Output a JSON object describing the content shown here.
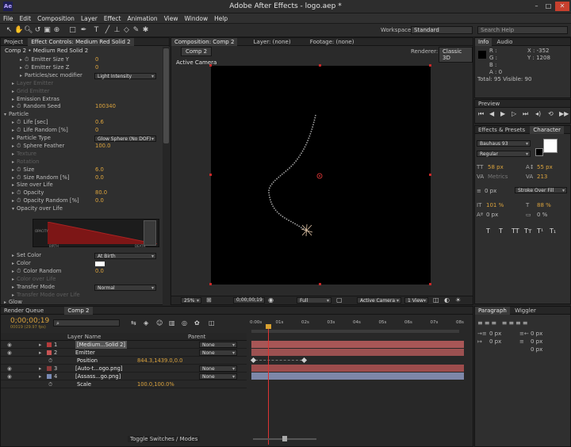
{
  "app": {
    "title": "Adobe After Effects - logo.aep *",
    "logo": "Ae",
    "min": "–",
    "max": "□",
    "close": "✕"
  },
  "menu": [
    "File",
    "Edit",
    "Composition",
    "Layer",
    "Effect",
    "Animation",
    "View",
    "Window",
    "Help"
  ],
  "toolbar": {
    "workspace_label": "Workspace:",
    "workspace_value": "Standard",
    "search_placeholder": "Search Help"
  },
  "left_panel": {
    "tabs": [
      "Project",
      "Effect Controls: Medium Red Solid 2"
    ],
    "breadcrumb": "Comp 2 • Medium Red Solid 2",
    "rows": [
      {
        "t": "Emitter Size Y",
        "v": "0",
        "i": 2,
        "k": "sw"
      },
      {
        "t": "Emitter Size Z",
        "v": "0",
        "i": 2,
        "k": "sw"
      },
      {
        "t": "Particles/sec modifier",
        "v": "Light Intensity",
        "i": 2,
        "k": "dd"
      },
      {
        "t": "Layer Emitter",
        "i": 1,
        "k": "tri",
        "dim": true
      },
      {
        "t": "Grid Emitter",
        "i": 1,
        "k": "tri",
        "dim": true
      },
      {
        "t": "Emission Extras",
        "i": 1,
        "k": "tri"
      },
      {
        "t": "Random Seed",
        "v": "100340",
        "i": 1,
        "k": "sw"
      },
      {
        "t": "Particle",
        "i": 0,
        "k": "open"
      },
      {
        "t": "Life [sec]",
        "v": "0.6",
        "i": 1,
        "k": "sw"
      },
      {
        "t": "Life Random [%]",
        "v": "0",
        "i": 1,
        "k": "sw"
      },
      {
        "t": "Particle Type",
        "v": "Glow Sphere (No DOF)",
        "i": 1,
        "k": "dd"
      },
      {
        "t": "Sphere Feather",
        "v": "100.0",
        "i": 1,
        "k": "sw"
      },
      {
        "t": "Texture",
        "i": 1,
        "k": "tri",
        "dim": true
      },
      {
        "t": "Rotation",
        "i": 1,
        "k": "tri",
        "dim": true
      },
      {
        "t": "Size",
        "v": "6.0",
        "i": 1,
        "k": "sw"
      },
      {
        "t": "Size Random [%]",
        "v": "0.0",
        "i": 1,
        "k": "sw"
      },
      {
        "t": "Size over Life",
        "i": 1,
        "k": "tri"
      },
      {
        "t": "Opacity",
        "v": "80.0",
        "i": 1,
        "k": "sw"
      },
      {
        "t": "Opacity Random [%]",
        "v": "0.0",
        "i": 1,
        "k": "sw"
      },
      {
        "t": "Opacity over Life",
        "i": 1,
        "k": "open"
      }
    ],
    "rows2": [
      {
        "t": "Set Color",
        "v": "At Birth",
        "i": 1,
        "k": "dd"
      },
      {
        "t": "Color",
        "i": 1,
        "k": "color"
      },
      {
        "t": "Color Random",
        "v": "0.0",
        "i": 1,
        "k": "sw"
      },
      {
        "t": "Color over Life",
        "i": 1,
        "k": "tri",
        "dim": true
      },
      {
        "t": "Transfer Mode",
        "v": "Normal",
        "i": 1,
        "k": "dd"
      },
      {
        "t": "Transfer Mode over Life",
        "i": 1,
        "k": "tri",
        "dim": true
      },
      {
        "t": "Glow",
        "i": 0,
        "k": "tri"
      }
    ],
    "graph": {
      "left_label": "OPACITY",
      "bottom_left": "BIRTH",
      "bottom_right": "DEATH"
    }
  },
  "comp": {
    "tabs": [
      "Composition: Comp 2",
      "Layer: (none)",
      "Footage: (none)"
    ],
    "subtab": "Comp 2",
    "renderer_label": "Renderer:",
    "renderer_value": "Classic 3D",
    "camera": "Active Camera",
    "footer": {
      "zoom": "25%",
      "time": "0;00;00;19",
      "res": "Full",
      "view": "Active Camera",
      "views": "1 View"
    }
  },
  "info": {
    "tabs": [
      "Info",
      "Audio"
    ],
    "r": "R :",
    "g": "G :",
    "b": "B :",
    "a": "A : 0",
    "x": "X : -352",
    "y": "Y : 1208",
    "summary": "Total: 95   Visible: 90"
  },
  "preview": {
    "tab": "Preview"
  },
  "character": {
    "tabs": [
      "Effects & Presets",
      "Character"
    ],
    "font": "Bauhaus 93",
    "style": "Regular",
    "size": "58 px",
    "leading": "55 px",
    "kerning": "Metrics",
    "tracking": "213",
    "stroke_w": "0 px",
    "stroke_type": "Stroke Over Fill",
    "vscale": "101 %",
    "hscale": "88 %",
    "baseline": "0 px",
    "tsume": "0 %",
    "styles": [
      "T",
      "T",
      "TT",
      "Tт",
      "T¹",
      "T₁"
    ]
  },
  "paragraph": {
    "tabs": [
      "Paragraph",
      "Wiggler"
    ],
    "i1": "0 px",
    "i2": "0 px",
    "i3": "0 px",
    "s1": "0 px",
    "s2": "0 px"
  },
  "timeline": {
    "tabs": [
      "Render Queue",
      "Comp 2"
    ],
    "time": "0;00;00;19",
    "frames": "00019 (29.97 fps)",
    "header": "Layer Name",
    "parent": "Parent",
    "ruler": [
      "0:00s",
      "01s",
      "02s",
      "03s",
      "04s",
      "05s",
      "06s",
      "07s",
      "08s"
    ],
    "layers": [
      {
        "num": "1",
        "name": "[Medium...Solid 2]",
        "parent": "None",
        "color": "#b53b3b",
        "bar": "#a85656"
      },
      {
        "num": "2",
        "name": "Emitter",
        "parent": "None",
        "color": "#c95555",
        "bar": "#9c5151"
      },
      {
        "num": "",
        "name": "Position",
        "value": "844.3,1439.0,0.0",
        "sub": true
      },
      {
        "num": "3",
        "name": "[Auto-t...ogo.png]",
        "parent": "None",
        "color": "#8f3a3a",
        "bar": "#9d4c4c"
      },
      {
        "num": "4",
        "name": "[Assass...go.png]",
        "parent": "None",
        "color": "#7a8bb5",
        "bar": "#7d87a8"
      },
      {
        "num": "",
        "name": "Scale",
        "value": "100.0,100.0%",
        "sub": true
      }
    ],
    "toggle": "Toggle Switches / Modes"
  }
}
